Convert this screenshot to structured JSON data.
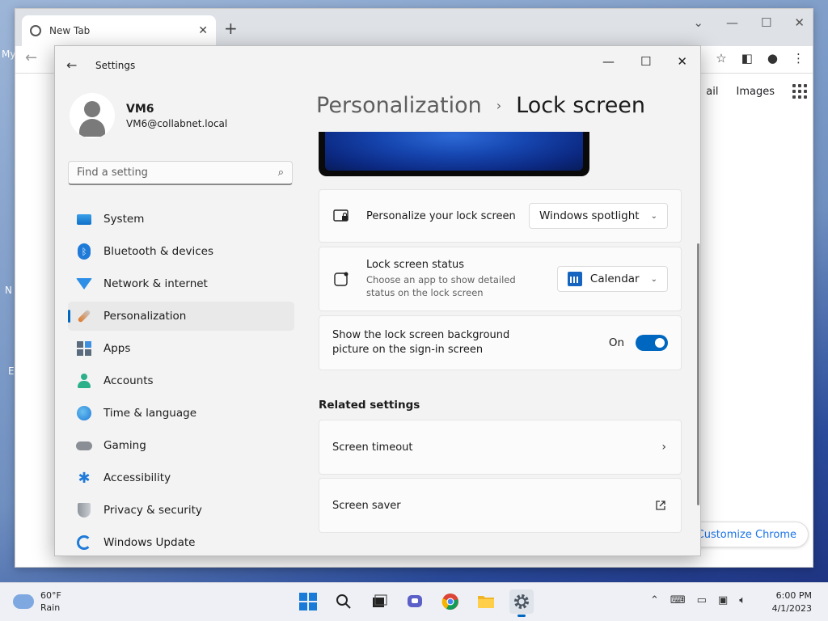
{
  "desktop": {
    "fragments": [
      "My",
      "N",
      "E"
    ]
  },
  "chrome": {
    "tab_title": "New Tab",
    "links": [
      "ail",
      "Images"
    ],
    "customize_label": "Customize Chrome"
  },
  "settings": {
    "window_title": "Settings",
    "user": {
      "name": "VM6",
      "email": "VM6@collabnet.local"
    },
    "search": {
      "placeholder": "Find a setting"
    },
    "nav": [
      {
        "label": "System",
        "icon": "system-icon"
      },
      {
        "label": "Bluetooth & devices",
        "icon": "bluetooth-icon"
      },
      {
        "label": "Network & internet",
        "icon": "network-icon"
      },
      {
        "label": "Personalization",
        "icon": "personalization-icon",
        "active": true
      },
      {
        "label": "Apps",
        "icon": "apps-icon"
      },
      {
        "label": "Accounts",
        "icon": "accounts-icon"
      },
      {
        "label": "Time & language",
        "icon": "time-language-icon"
      },
      {
        "label": "Gaming",
        "icon": "gaming-icon"
      },
      {
        "label": "Accessibility",
        "icon": "accessibility-icon"
      },
      {
        "label": "Privacy & security",
        "icon": "privacy-icon"
      },
      {
        "label": "Windows Update",
        "icon": "windows-update-icon"
      }
    ],
    "breadcrumb": {
      "parent": "Personalization",
      "separator": "›",
      "current": "Lock screen"
    },
    "personalize": {
      "label": "Personalize your lock screen",
      "value": "Windows spotlight"
    },
    "status": {
      "label": "Lock screen status",
      "description": "Choose an app to show detailed status on the lock screen",
      "value": "Calendar"
    },
    "signin_bg": {
      "label": "Show the lock screen background picture on the sign-in screen",
      "state": "On",
      "enabled": true
    },
    "related": {
      "heading": "Related settings",
      "items": [
        {
          "label": "Screen timeout",
          "icon": "chevron-right-icon"
        },
        {
          "label": "Screen saver",
          "icon": "open-external-icon"
        }
      ]
    }
  },
  "taskbar": {
    "weather": {
      "temp": "60°F",
      "condition": "Rain"
    },
    "clock": {
      "time": "6:00 PM",
      "date": "4/1/2023"
    }
  },
  "colors": {
    "accent": "#0067c0",
    "link": "#1a73e8"
  }
}
